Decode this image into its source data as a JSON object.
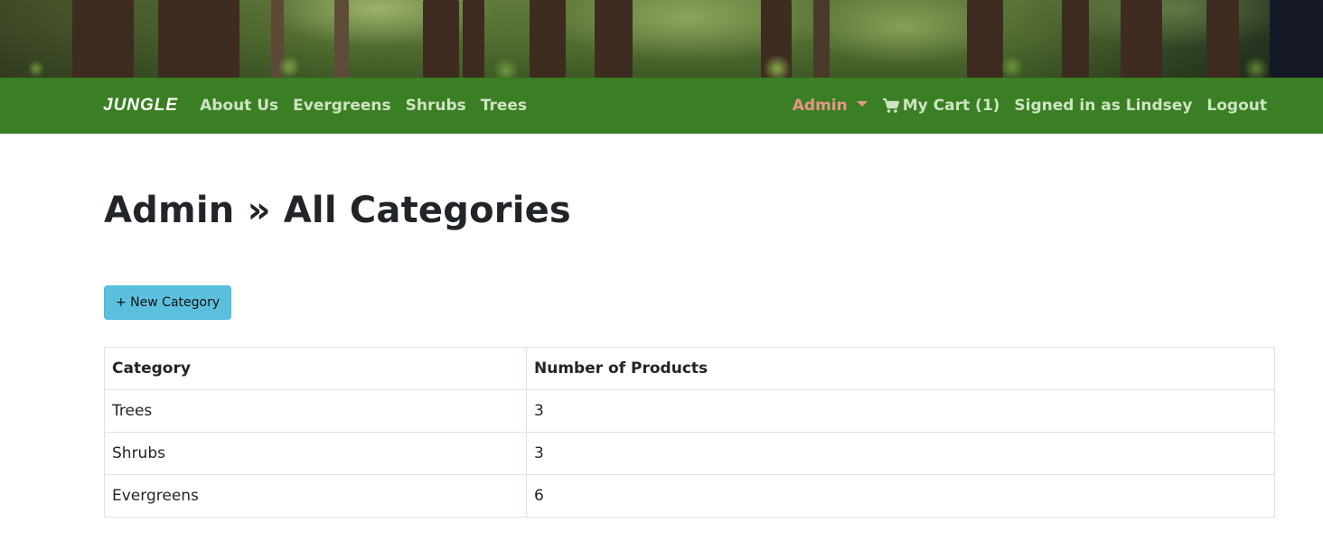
{
  "navbar": {
    "brand": "JUNGLE",
    "links": [
      "About Us",
      "Evergreens",
      "Shrubs",
      "Trees"
    ],
    "admin": "Admin",
    "cart": "My Cart (1)",
    "signed_in": "Signed in as Lindsey",
    "logout": "Logout"
  },
  "page": {
    "title": "Admin » All Categories",
    "new_button": "+ New Category"
  },
  "table": {
    "headers": [
      "Category",
      "Number of Products"
    ],
    "rows": [
      [
        "Trees",
        "3"
      ],
      [
        "Shrubs",
        "3"
      ],
      [
        "Evergreens",
        "6"
      ]
    ]
  },
  "colors": {
    "navbar": "#3a7f23",
    "nav_link": "#cfe3c3",
    "admin_link": "#e8958a",
    "button": "#5bc0de"
  }
}
